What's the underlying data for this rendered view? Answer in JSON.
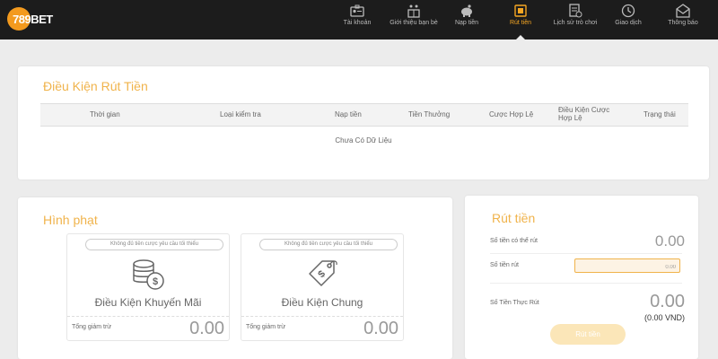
{
  "brand": {
    "logo_text": "789BET",
    "accent": "#f5a623"
  },
  "nav": {
    "items": [
      {
        "label": "Tài khoản",
        "icon": "account-icon"
      },
      {
        "label": "Giới thiệu bạn bè",
        "icon": "referral-icon"
      },
      {
        "label": "Nạp tiền",
        "icon": "piggy-bank-icon"
      },
      {
        "label": "Rút tiền",
        "icon": "withdraw-icon",
        "active": true
      },
      {
        "label": "Lịch sử trò chơi",
        "icon": "game-history-icon"
      },
      {
        "label": "Giao dịch",
        "icon": "transaction-clock-icon"
      },
      {
        "label": "Thông báo",
        "icon": "mail-icon"
      }
    ]
  },
  "conditions": {
    "title": "Điều Kiện Rút Tiền",
    "columns": [
      "Thời gian",
      "Loại kiểm tra",
      "Nạp tiền",
      "Tiền Thưởng",
      "Cược Hợp Lệ",
      "Điều Kiện Cược Hợp Lệ",
      "Trạng thái"
    ],
    "empty_message": "Chưa Có Dữ Liệu"
  },
  "penalty": {
    "title": "Hình phạt",
    "cards": [
      {
        "note": "Không đủ tiền cược yêu cầu tối thiểu",
        "name": "Điều Kiện Khuyến Mãi",
        "deduct_label": "Tổng giảm trừ",
        "deduct_value": "0.00",
        "icon": "coins-dollar-icon"
      },
      {
        "note": "Không đủ tiền cược yêu cầu tối thiểu",
        "name": "Điều Kiện Chung",
        "deduct_label": "Tổng giảm trừ",
        "deduct_value": "0.00",
        "icon": "price-tag-dollar-icon"
      }
    ]
  },
  "withdraw": {
    "title": "Rút tiền",
    "available_label": "Số tiền có thể rút",
    "available_value": "0.00",
    "amount_label": "Số tiền rút",
    "amount_value": "0.00",
    "actual_label": "Số Tiền Thực Rút",
    "actual_value": "0.00",
    "actual_vnd": "(0.00 VND)",
    "button_label": "Rút tiền"
  }
}
